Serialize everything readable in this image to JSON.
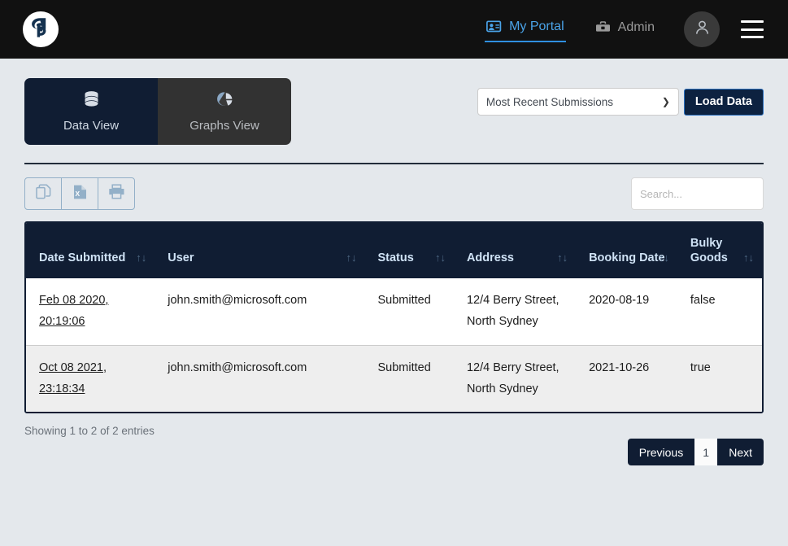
{
  "navbar": {
    "logo_text": "GP",
    "logo_name": "company-logo",
    "links": [
      {
        "label": "My Portal",
        "icon": "user-card-icon",
        "active": true
      },
      {
        "label": "Admin",
        "icon": "toolbox-icon",
        "active": false
      }
    ],
    "avatar_icon": "user-avatar-icon",
    "menu_icon": "hamburger-menu-icon"
  },
  "tabs": [
    {
      "label": "Data View",
      "icon": "database-icon",
      "selected": true
    },
    {
      "label": "Graphs View",
      "icon": "pie-chart-icon",
      "selected": false
    }
  ],
  "controls": {
    "select_value": "Most Recent Submissions",
    "select_caret": "chevron-down-icon",
    "load_button": "Load Data"
  },
  "toolbar": {
    "buttons": [
      {
        "name": "copy-button",
        "icon": "copy-icon"
      },
      {
        "name": "excel-export-button",
        "icon": "excel-file-icon"
      },
      {
        "name": "print-button",
        "icon": "printer-icon"
      }
    ],
    "search_placeholder": "Search...",
    "search_value": ""
  },
  "table": {
    "sort_icon": "↑↓",
    "columns": [
      "Date Submitted",
      "User",
      "Status",
      "Address",
      "Booking Date",
      "Bulky Goods"
    ],
    "rows": [
      {
        "date_submitted": "Feb 08 2020, 20:19:06",
        "user": "john.smith@microsoft.com",
        "status": "Submitted",
        "address": "12/4 Berry Street, North Sydney",
        "booking_date": "2020-08-19",
        "bulky_goods": "false"
      },
      {
        "date_submitted": "Oct 08 2021, 23:18:34",
        "user": "john.smith@microsoft.com",
        "status": "Submitted",
        "address": "12/4 Berry Street, North Sydney",
        "booking_date": "2021-10-26",
        "bulky_goods": "true"
      }
    ]
  },
  "footer": {
    "showing": "Showing 1 to 2 of 2 entries",
    "previous": "Previous",
    "page_number": "1",
    "next": "Next"
  },
  "colors": {
    "navy": "#101d33",
    "page_bg": "#e4e8ec",
    "navbar_bg": "#111111",
    "accent_blue": "#4aa3e8",
    "header_text": "#cfe2f5"
  }
}
